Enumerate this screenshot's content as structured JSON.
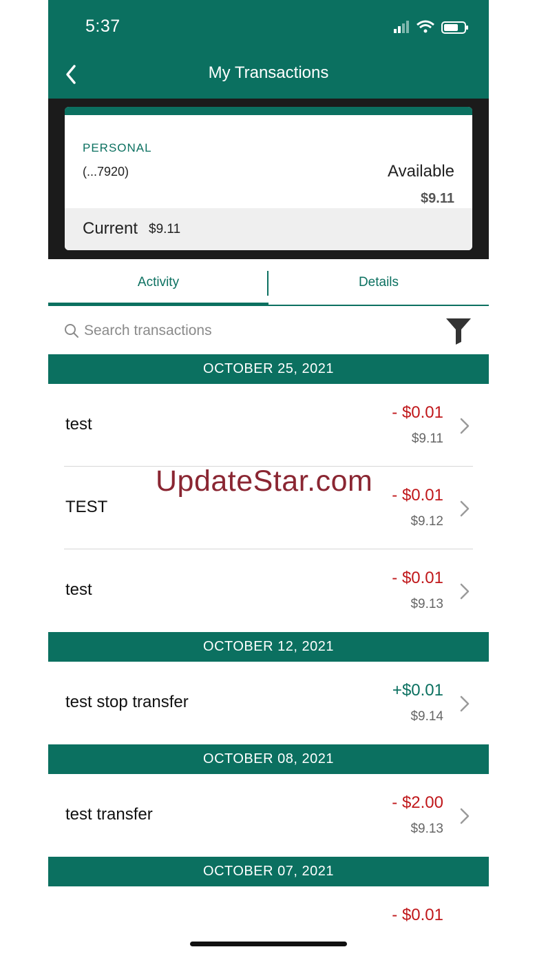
{
  "status_bar": {
    "time": "5:37"
  },
  "header": {
    "title": "My Transactions",
    "back_icon": "chevron-left-icon"
  },
  "account_card": {
    "type": "PERSONAL",
    "number": "(...7920)",
    "available_label": "Available",
    "available_value": "$9.11",
    "current_label": "Current",
    "current_value": "$9.11"
  },
  "tabs": [
    {
      "label": "Activity",
      "active": true
    },
    {
      "label": "Details",
      "active": false
    }
  ],
  "search": {
    "placeholder": "Search transactions"
  },
  "groups": [
    {
      "date": "OCTOBER 25, 2021",
      "transactions": [
        {
          "description": "test",
          "amount": "- $0.01",
          "balance": "$9.11",
          "kind": "debit"
        },
        {
          "description": "TEST",
          "amount": "- $0.01",
          "balance": "$9.12",
          "kind": "debit"
        },
        {
          "description": "test",
          "amount": "- $0.01",
          "balance": "$9.13",
          "kind": "debit"
        }
      ]
    },
    {
      "date": "OCTOBER 12, 2021",
      "transactions": [
        {
          "description": "test stop transfer",
          "amount": "+$0.01",
          "balance": "$9.14",
          "kind": "credit"
        }
      ]
    },
    {
      "date": "OCTOBER 08, 2021",
      "transactions": [
        {
          "description": "test transfer",
          "amount": "- $2.00",
          "balance": "$9.13",
          "kind": "debit"
        }
      ]
    },
    {
      "date": "OCTOBER 07, 2021",
      "transactions": [
        {
          "description": "",
          "amount": "- $0.01",
          "balance": "",
          "kind": "debit"
        }
      ]
    }
  ],
  "watermark": "UpdateStar.com",
  "colors": {
    "brand": "#0b7060",
    "debit": "#c0181b",
    "credit": "#0b7060"
  }
}
